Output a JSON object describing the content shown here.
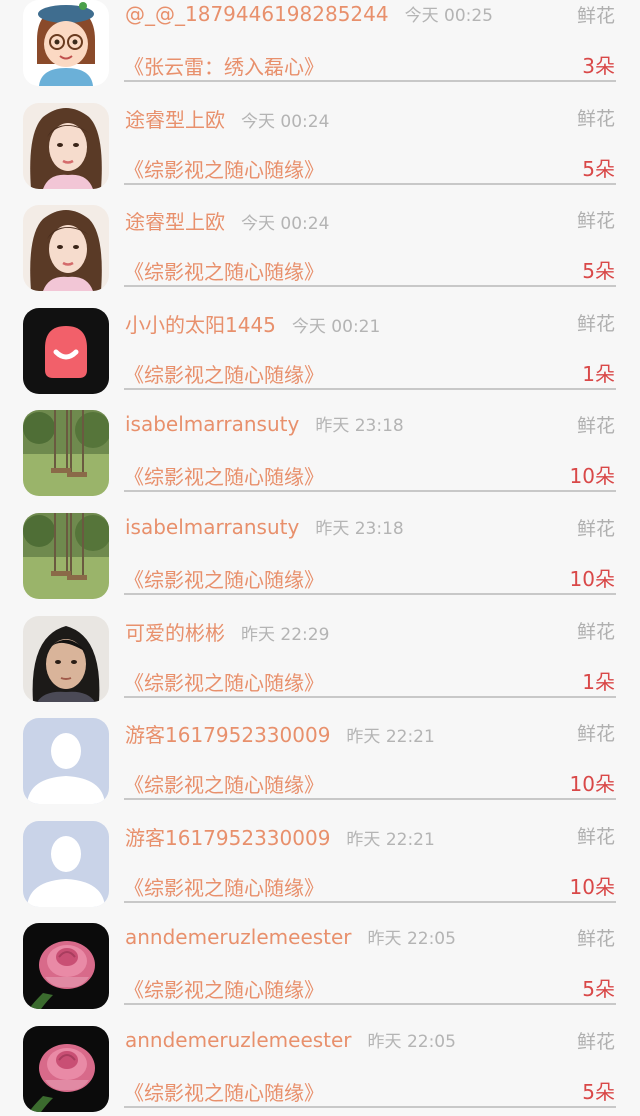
{
  "rows": [
    {
      "avatar": "cartoon-girl-avatar",
      "username": "@_@_1879446198285244",
      "time": "今天 00:25",
      "gift_type": "鲜花",
      "book": "《张云雷：绣入磊心》",
      "count": "3朵"
    },
    {
      "avatar": "woman-photo-avatar",
      "username": "途睿型上欧",
      "time": "今天 00:24",
      "gift_type": "鲜花",
      "book": "《综影视之随心随缘》",
      "count": "5朵"
    },
    {
      "avatar": "woman-photo-avatar",
      "username": "途睿型上欧",
      "time": "今天 00:24",
      "gift_type": "鲜花",
      "book": "《综影视之随心随缘》",
      "count": "5朵"
    },
    {
      "avatar": "app-logo-avatar",
      "username": "小小的太阳1445",
      "time": "今天 00:21",
      "gift_type": "鲜花",
      "book": "《综影视之随心随缘》",
      "count": "1朵"
    },
    {
      "avatar": "swing-photo-avatar",
      "username": "isabelmarransuty",
      "time": "昨天 23:18",
      "gift_type": "鲜花",
      "book": "《综影视之随心随缘》",
      "count": "10朵"
    },
    {
      "avatar": "swing-photo-avatar",
      "username": "isabelmarransuty",
      "time": "昨天 23:18",
      "gift_type": "鲜花",
      "book": "《综影视之随心随缘》",
      "count": "10朵"
    },
    {
      "avatar": "girl-photo-avatar",
      "username": "可爱的彬彬",
      "time": "昨天 22:29",
      "gift_type": "鲜花",
      "book": "《综影视之随心随缘》",
      "count": "1朵"
    },
    {
      "avatar": "default-user-avatar",
      "username": "游客1617952330009",
      "time": "昨天 22:21",
      "gift_type": "鲜花",
      "book": "《综影视之随心随缘》",
      "count": "10朵"
    },
    {
      "avatar": "default-user-avatar",
      "username": "游客1617952330009",
      "time": "昨天 22:21",
      "gift_type": "鲜花",
      "book": "《综影视之随心随缘》",
      "count": "10朵"
    },
    {
      "avatar": "rose-photo-avatar",
      "username": "anndemeruzlemeester",
      "time": "昨天 22:05",
      "gift_type": "鲜花",
      "book": "《综影视之随心随缘》",
      "count": "5朵"
    },
    {
      "avatar": "rose-photo-avatar",
      "username": "anndemeruzlemeester",
      "time": "昨天 22:05",
      "gift_type": "鲜花",
      "book": "《综影视之随心随缘》",
      "count": "5朵"
    }
  ]
}
